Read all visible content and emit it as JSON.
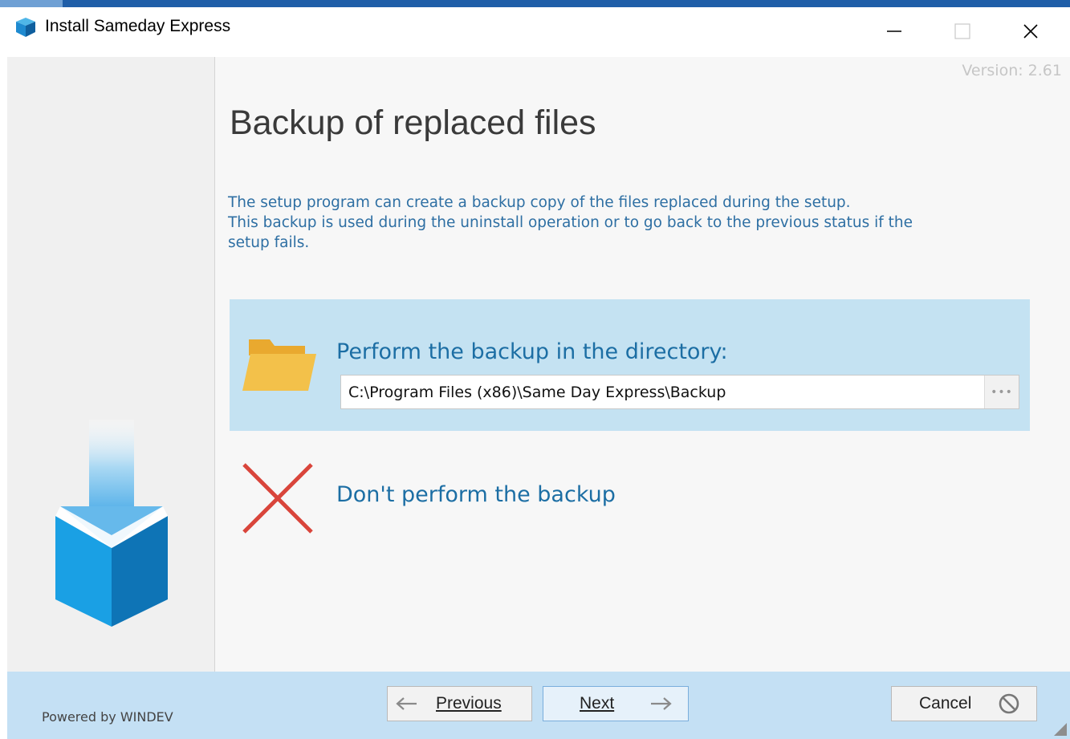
{
  "window": {
    "title": "Install Sameday Express",
    "icon": "app-box-icon",
    "controls": [
      "minimize-icon",
      "maximize-icon",
      "close-icon"
    ]
  },
  "main": {
    "version": "Version: 2.61",
    "heading": "Backup of replaced files",
    "description_lines": [
      "The setup program can create a backup copy of the files replaced during the setup.",
      "This backup is used during the uninstall operation or to go back to the previous status if the",
      "setup fails."
    ],
    "options": {
      "backup": {
        "label": "Perform the backup in the directory:",
        "path": "C:\\Program Files (x86)\\Same Day Express\\Backup",
        "browse_label": "•••",
        "icon": "folder-icon",
        "selected": true
      },
      "no_backup": {
        "label": "Don't perform the backup",
        "icon": "red-x-icon",
        "selected": false
      }
    }
  },
  "footer": {
    "powered_by": "Powered by WINDEV",
    "previous_label": "Previous",
    "next_label": "Next",
    "cancel_label": "Cancel"
  },
  "colors": {
    "accent_blue": "#1c6ea4",
    "selected_bg": "#c4e2f2",
    "footer_bg": "#c4e0f4",
    "folder_yellow": "#f0bc42",
    "x_red": "#d9453b"
  }
}
